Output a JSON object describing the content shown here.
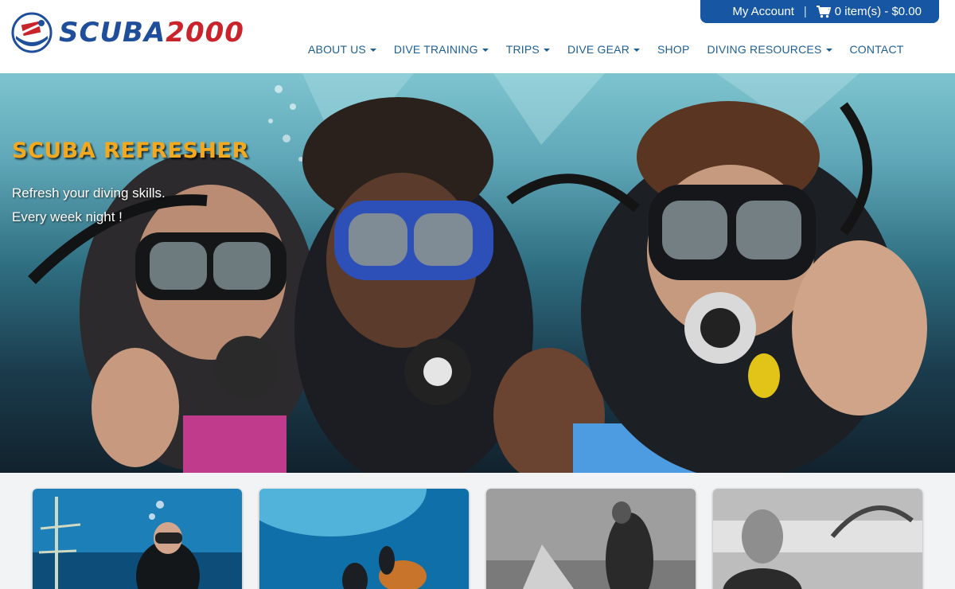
{
  "brand": {
    "logo_part1": "SCUBA",
    "logo_part2": "2000"
  },
  "account": {
    "my_account": "My Account",
    "cart": "0 item(s) - $0.00"
  },
  "nav": {
    "items": [
      {
        "label": "ABOUT US",
        "dropdown": true
      },
      {
        "label": "DIVE TRAINING",
        "dropdown": true
      },
      {
        "label": "TRIPS",
        "dropdown": true
      },
      {
        "label": "DIVE GEAR",
        "dropdown": true
      },
      {
        "label": "SHOP",
        "dropdown": false
      },
      {
        "label": "DIVING RESOURCES",
        "dropdown": true
      },
      {
        "label": "CONTACT",
        "dropdown": false
      }
    ]
  },
  "hero": {
    "title": "SCUBA REFRESHER",
    "line1": "Refresh your diving skills.",
    "line2": "Every week night !"
  },
  "colors": {
    "brand_blue": "#1656a3",
    "nav_text": "#1d5f93",
    "hero_title": "#f3a91f",
    "logo_red": "#c9232b"
  },
  "icons": [
    "dive-flag-logo-icon",
    "shopping-cart-icon",
    "caret-down-icon"
  ]
}
